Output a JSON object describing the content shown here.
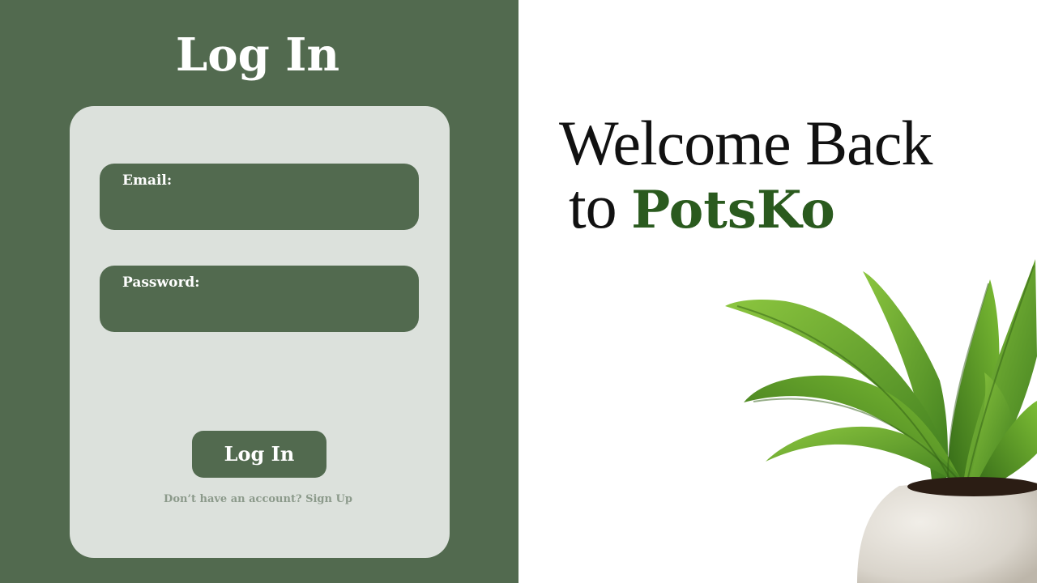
{
  "left_panel": {
    "title": "Log In"
  },
  "form": {
    "email_label": "Email:",
    "email_value": "",
    "password_label": "Password:",
    "password_value": "",
    "submit_label": "Log In",
    "signup_prompt": "Don’t have an account?",
    "signup_link": "Sign Up"
  },
  "welcome": {
    "line1": "Welcome Back",
    "line2_prefix": "to",
    "brand": "PotsKo"
  },
  "icons": {
    "plant": "potted-plant-icon"
  },
  "colors": {
    "panel_green": "#526a4f",
    "card_bg": "#dce1dc",
    "brand_green": "#2a5a1e",
    "muted_text": "#8c9a8b"
  }
}
